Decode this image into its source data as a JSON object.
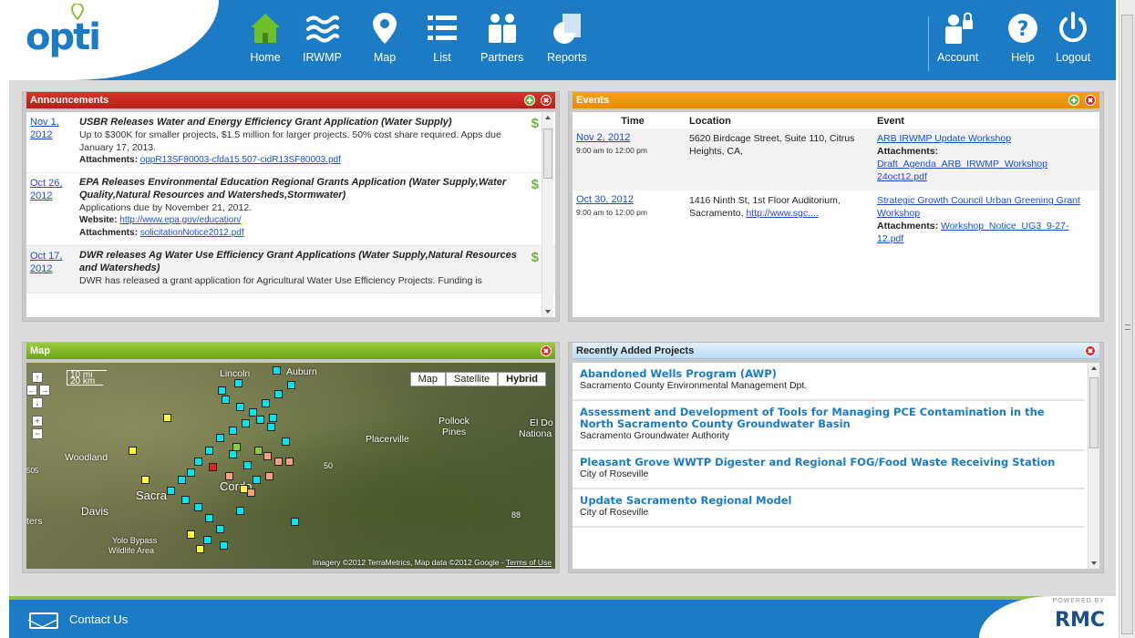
{
  "app": {
    "logo_text": "opti"
  },
  "nav": {
    "home": "Home",
    "irwmp": "IRWMP",
    "map": "Map",
    "list": "List",
    "partners": "Partners",
    "reports": "Reports",
    "account": "Account",
    "help": "Help",
    "logout": "Logout"
  },
  "announcements": {
    "title": "Announcements",
    "items": [
      {
        "date": "Nov 1, 2012",
        "title": "USBR Releases Water and Energy Efficiency Grant Application (Water Supply)",
        "text": "Up to $300K for smaller projects, $1.5 million for larger projects. 50% cost share required. Apps due January 17, 2013.",
        "website_label": "",
        "website": "",
        "attach_label": "Attachments:",
        "attachment": "oppR13SF80003-cfda15.507-cidR13SF80003.pdf"
      },
      {
        "date": "Oct 26, 2012",
        "title": "EPA Releases Environmental Education Regional Grants Application (Water Supply,Water Quality,Natural Resources and Watersheds,Stormwater)",
        "text": "Applications due by November 21, 2012.",
        "website_label": "Website:",
        "website": "http://www.epa.gov/education/",
        "attach_label": "Attachments:",
        "attachment": "solicitationNotice2012.pdf"
      },
      {
        "date": "Oct 17, 2012",
        "title": "DWR releases Ag Water Use Efficiency Grant Applications (Water Supply,Natural Resources and Watersheds)",
        "text": "DWR has released a grant application for Agricultural Water Use Efficiency Projects. Funding is",
        "website_label": "",
        "website": "",
        "attach_label": "",
        "attachment": ""
      }
    ]
  },
  "events": {
    "title": "Events",
    "col_time": "Time",
    "col_location": "Location",
    "col_event": "Event",
    "rows": [
      {
        "date": "Nov 2, 2012",
        "time": "9:00 am to 12:00 pm",
        "location": "5620 Birdcage Street, Suite 110, Citrus Heights, CA,",
        "location_link": "",
        "event": "ARB IRWMP Update Workshop",
        "attach_label": "Attachments:",
        "attachment": "Draft_Agenda_ARB_IRWMP_Workshop 24oct12.pdf"
      },
      {
        "date": "Oct 30, 2012",
        "time": "9:00 am to 12:00 pm",
        "location": "1416 Ninth St, 1st Floor Auditorium, Sacramento,",
        "location_link": "http://www.sgc....",
        "event": "Strategic Growth Council Urban Greening Grant Workshop",
        "attach_label": "Attachments:",
        "attachment": "Workshop_Notice_UG3_9-27-12.pdf"
      }
    ]
  },
  "map": {
    "title": "Map",
    "type_map": "Map",
    "type_satellite": "Satellite",
    "type_hybrid": "Hybrid",
    "scale_mi": "10 mi",
    "scale_km": "20 km",
    "labels": {
      "lincoln": "Lincoln",
      "auburn": "Auburn",
      "pollock": "Pollock",
      "pines": "Pines",
      "placerville": "Placerville",
      "eldo": "El Do",
      "nationa": "Nationa",
      "woodland": "Woodland",
      "sacra": "Sacra",
      "cordo": "Cordo",
      "davis": "Davis",
      "ters": "ters",
      "yolo": "Yolo Bypass",
      "wildlife": "Wildlife Area",
      "route50": "50",
      "route88": "88",
      "route505": "505"
    },
    "credit": "Imagery ©2012 TerraMetrics, Map data ©2012 Google -",
    "terms": "Terms of Use"
  },
  "projects": {
    "title": "Recently Added Projects",
    "items": [
      {
        "title": "Abandoned Wells Program (AWP)",
        "org": "Sacramento County Environmental Management Dpt."
      },
      {
        "title": "Assessment and Development of Tools for Managing PCE Contamination in the North Sacramento County Groundwater Basin",
        "org": "Sacramento Groundwater Authority"
      },
      {
        "title": "Pleasant Grove WWTP Digester and Regional FOG/Food Waste Receiving Station",
        "org": "City of Roseville"
      },
      {
        "title": "Update Sacramento Regional Model",
        "org": "City of Roseville"
      }
    ]
  },
  "footer": {
    "contact": "Contact Us",
    "powered": "POWERED BY",
    "brand": "RMC"
  },
  "colors": {
    "brand_blue": "#1b7bc4",
    "ann_red": "#c82a22",
    "events_orange": "#f39a10",
    "map_green": "#8bbd2f",
    "footer_green": "#8dc23c"
  },
  "map_markers": [
    {
      "c": "#00e5ee"
    },
    {
      "c": "#00e5ee"
    },
    {
      "c": "#00e5ee"
    },
    {
      "c": "#00e5ee"
    },
    {
      "c": "#00e5ee"
    },
    {
      "c": "#00e5ee"
    }
  ]
}
